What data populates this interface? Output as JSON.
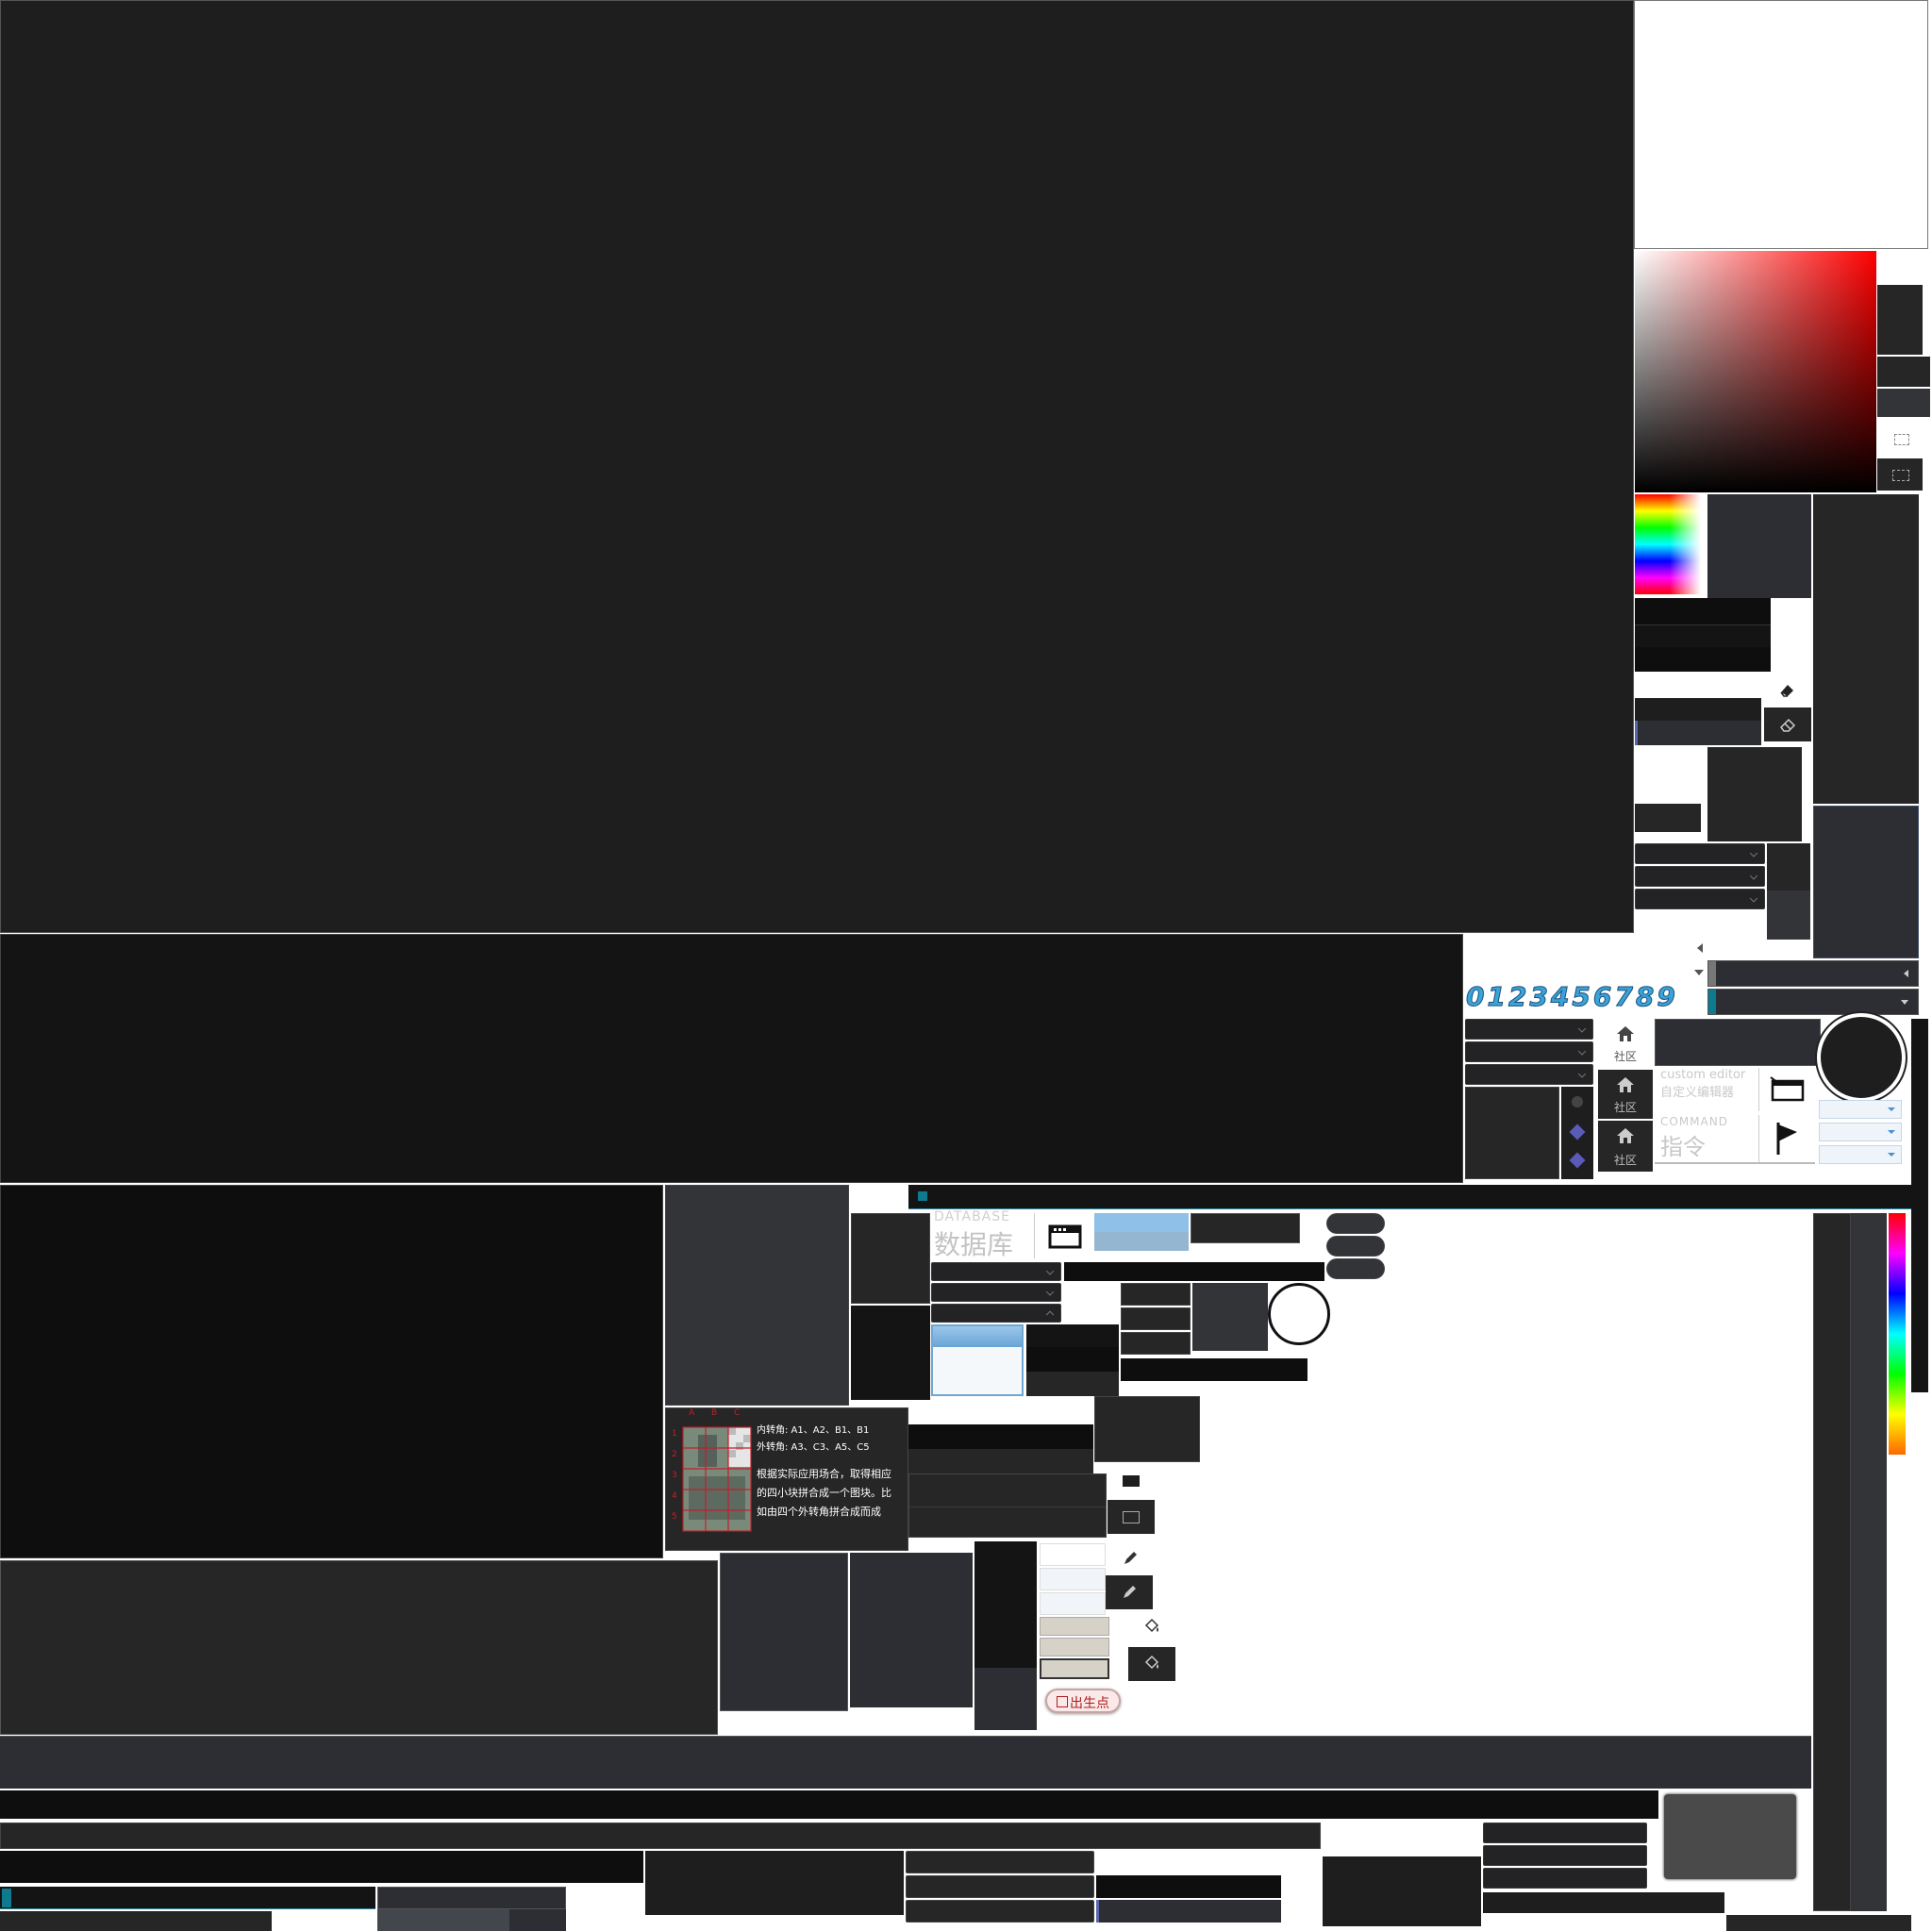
{
  "palette": {
    "dark": "#1e1e1e",
    "darker": "#141414",
    "panel": "#262626",
    "accent_teal": "#0e7a8e",
    "accent_blue_light": "#8fc1e8",
    "marker_red": "#c0202a"
  },
  "digits_strip": "0123456789",
  "community": {
    "label_1": "社区",
    "label_2": "社区",
    "label_3": "社区"
  },
  "custom_editor": {
    "en": "custom editor",
    "zh": "自定义编辑器"
  },
  "command": {
    "en": "COMMAND",
    "zh": "指令"
  },
  "database": {
    "en": "DATABASE",
    "zh": "数据库"
  },
  "tile_hint": {
    "columns": [
      "A",
      "B",
      "C"
    ],
    "rows": [
      "1",
      "2",
      "3",
      "4",
      "5"
    ],
    "inner_corners": "内转角: A1、A2、B1、B1",
    "outer_corners": "外转角: A3、C3、A5、C5",
    "line1": "根据实际应用场合，取得相应",
    "line2": "的四小块拼合成一个图块。比",
    "line3": "如由四个外转角拼合成而成"
  },
  "spawn_point": {
    "label": "出生点"
  },
  "icons": {
    "eraser": "eraser-icon",
    "pencil": "pencil-icon",
    "bucket": "paint-bucket-icon",
    "window": "window-icon",
    "flag": "flag-icon",
    "house": "house-icon",
    "cube": "cube-icon"
  }
}
